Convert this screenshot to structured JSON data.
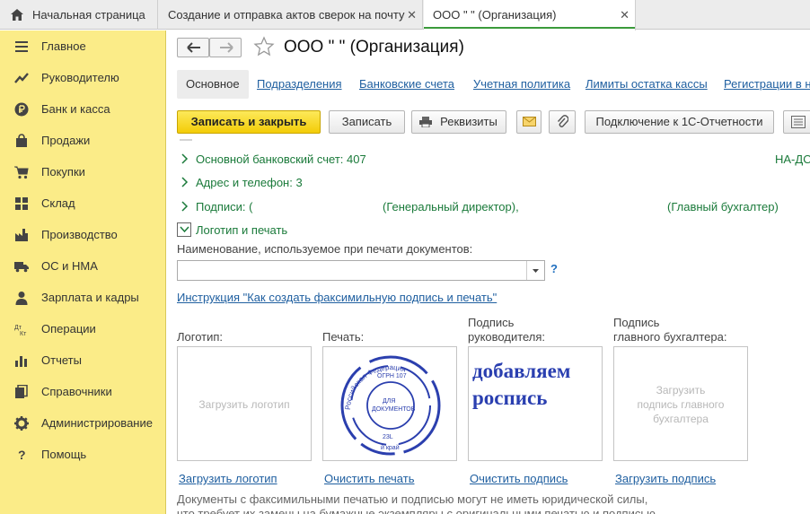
{
  "tabs": {
    "home": "Начальная страница",
    "tab1": "Создание и отправка актов сверок на почту",
    "tab2": "ООО \"                    \" (Организация)",
    "close": "✕"
  },
  "sidebar": {
    "items": [
      {
        "label": "Главное",
        "icon": "menu-lines-icon"
      },
      {
        "label": "Руководителю",
        "icon": "trend-icon"
      },
      {
        "label": "Банк и касса",
        "icon": "ruble-coin-icon"
      },
      {
        "label": "Продажи",
        "icon": "shopping-bag-icon"
      },
      {
        "label": "Покупки",
        "icon": "cart-icon"
      },
      {
        "label": "Склад",
        "icon": "warehouse-grid-icon"
      },
      {
        "label": "Производство",
        "icon": "factory-icon"
      },
      {
        "label": "ОС и НМА",
        "icon": "truck-icon"
      },
      {
        "label": "Зарплата и кадры",
        "icon": "person-icon"
      },
      {
        "label": "Операции",
        "icon": "dt-kt-icon"
      },
      {
        "label": "Отчеты",
        "icon": "bar-chart-icon"
      },
      {
        "label": "Справочники",
        "icon": "books-icon"
      },
      {
        "label": "Администрирование",
        "icon": "gear-icon"
      },
      {
        "label": "Помощь",
        "icon": "question-icon"
      }
    ]
  },
  "header": {
    "title": "ООО \"                    \" (Организация)"
  },
  "form_tabs": [
    "Основное",
    "Подразделения",
    "Банковские счета",
    "Учетная политика",
    "Лимиты остатка кассы",
    "Регистрации в н"
  ],
  "toolbar": {
    "save_close": "Записать и закрыть",
    "save": "Записать",
    "details": "Реквизиты",
    "connect": "Подключение к 1С-Отчетности"
  },
  "sections": {
    "bank": "Основной банковский счет: 407",
    "bank_right": "НА-ДО",
    "address": "Адрес и телефон: 3",
    "signs": "Подписи: (",
    "director": "(Генеральный директор),",
    "accountant": "(Главный бухгалтер)",
    "logo_section": "Логотип и печать"
  },
  "print_name": {
    "label": "Наименование, используемое при печати документов:",
    "value": "",
    "help": "?"
  },
  "instruction_link": "Инструкция \"Как создать факсимильную подпись и печать\"",
  "images": {
    "logo_label": "Логотип:",
    "stamp_label": "Печать:",
    "head_label_1": "Подпись",
    "head_label_2": "руководителя:",
    "acc_label_1": "Подпись",
    "acc_label_2": "главного бухгалтера:",
    "logo_placeholder": "Загрузить логотип",
    "acc_placeholder_1": "Загрузить",
    "acc_placeholder_2": "подпись главного",
    "acc_placeholder_3": "бухгалтера",
    "signature_line_1": "добавляем",
    "signature_line_2": "роспись",
    "stamp_text": {
      "arc": "Российская Федерация",
      "inner": "ОГРН 107",
      "center_1": "ДЛЯ",
      "center_2": "ДОКУМЕНТОВ",
      "bottom": "23L",
      "region": "й край"
    },
    "logo_action": "Загрузить логотип",
    "stamp_action": "Очистить печать",
    "head_action": "Очистить подпись",
    "acc_action": "Загрузить подпись"
  },
  "notes": {
    "line1": "Документы с факсимильными печатью и подписью могут не иметь юридической силы,",
    "line2": "что требует их замены на бумажные экземпляры с оригинальными печатью и подписью"
  },
  "colors": {
    "accent": "#f3cc07",
    "sidebar": "#fbec88",
    "link": "#1f5fa0",
    "section": "#1a7a3a",
    "signature": "#2a3fb0",
    "stamp": "#2b3fae"
  }
}
